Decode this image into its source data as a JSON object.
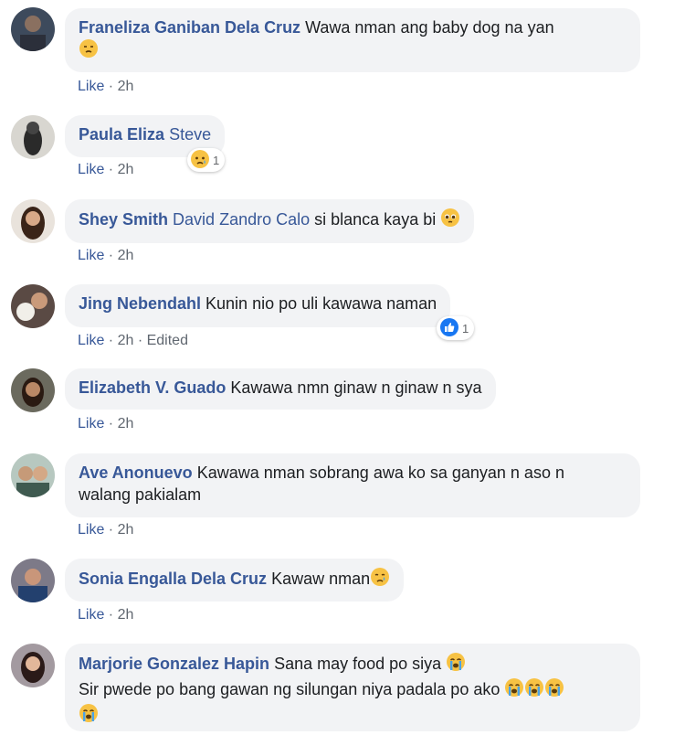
{
  "comments": [
    {
      "author": "Franeliza Ganiban Dela Cruz",
      "text": "Wawa nman ang baby dog na yan",
      "like_label": "Like",
      "time": "2h"
    },
    {
      "author": "Paula Eliza",
      "mention": "Steve",
      "like_label": "Like",
      "time": "2h",
      "reaction_count": "1"
    },
    {
      "author": "Shey Smith",
      "mention": "David Zandro Calo",
      "text": "si blanca kaya bi",
      "like_label": "Like",
      "time": "2h"
    },
    {
      "author": "Jing Nebendahl",
      "text": "Kunin nio po uli kawawa naman",
      "like_label": "Like",
      "time": "2h",
      "edited": "Edited",
      "reaction_count": "1"
    },
    {
      "author": "Elizabeth V. Guado",
      "text": "Kawawa nmn ginaw n ginaw n sya",
      "like_label": "Like",
      "time": "2h"
    },
    {
      "author": "Ave Anonuevo",
      "text_line1": "Kawawa nman sobrang awa ko sa ganyan n aso n",
      "text_line2": "walang pakialam",
      "like_label": "Like",
      "time": "2h"
    },
    {
      "author": "Sonia Engalla Dela Cruz",
      "text": "Kawaw nman",
      "like_label": "Like",
      "time": "2h"
    },
    {
      "author": "Marjorie Gonzalez Hapin",
      "text_line1": "Sana may food po siya",
      "text_line2": "Sir pwede po bang gawan ng silungan niya padala po ako"
    }
  ],
  "colors": {
    "link": "#385898",
    "bubble": "#f2f3f5",
    "meta": "#606770"
  }
}
